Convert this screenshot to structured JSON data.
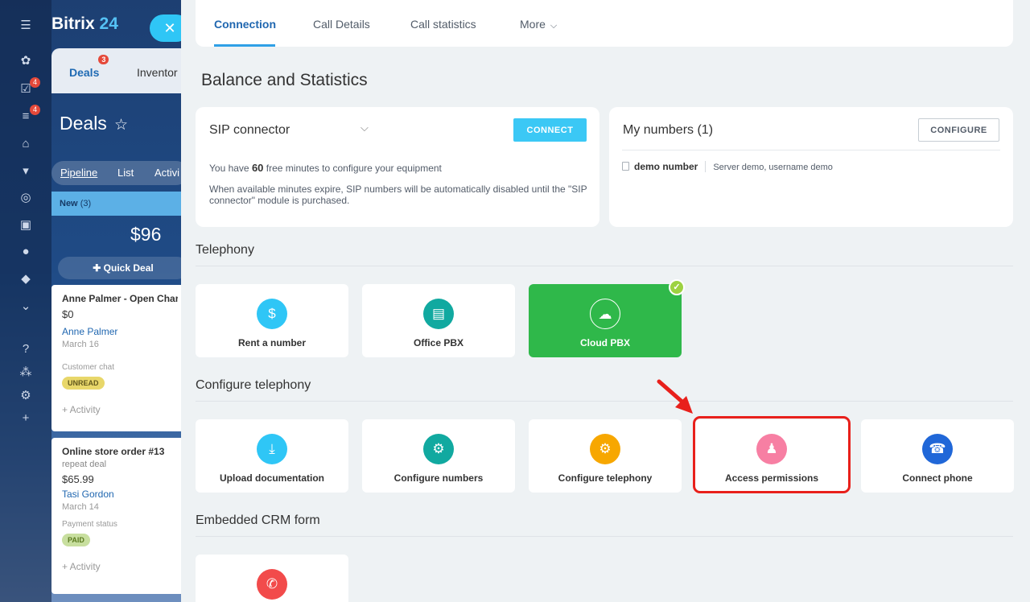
{
  "background": {
    "brand": {
      "name": "Bitrix",
      "number": "24"
    },
    "nav_badges": [
      "4",
      "4"
    ],
    "crm_tabs": {
      "deals": "Deals",
      "deals_badge": "3",
      "inventory": "Inventor"
    },
    "page_title": "Deals",
    "views": [
      "Pipeline",
      "List",
      "Activi"
    ],
    "stage": {
      "name": "New",
      "count": "(3)",
      "sum": "$96"
    },
    "quick_deal": "Quick Deal",
    "cards": [
      {
        "title": "Anne Palmer - Open Char",
        "subtitle": "",
        "price": "$0",
        "client": "Anne Palmer",
        "date": "March 16",
        "field": "Customer chat",
        "tag": "UNREAD",
        "activity": "+ Activity"
      },
      {
        "title": "Online store order #13",
        "subtitle": "repeat deal",
        "price": "$65.99",
        "client": "Tasi Gordon",
        "date": "March 14",
        "field": "Payment status",
        "tag": "PAID",
        "activity": "+ Activity"
      }
    ]
  },
  "tabs": [
    {
      "label": "Connection",
      "active": true
    },
    {
      "label": "Call Details",
      "active": false
    },
    {
      "label": "Call statistics",
      "active": false
    },
    {
      "label": "More",
      "active": false
    }
  ],
  "balance": {
    "title": "Balance and Statistics",
    "sip": {
      "title": "SIP connector",
      "connect_label": "CONNECT",
      "line1_pre": "You have",
      "minutes": "60",
      "line1_post": "free minutes to configure your equipment",
      "line2": "When available minutes expire, SIP numbers will be automatically disabled until the \"SIP connector\" module is purchased."
    },
    "numbers": {
      "title": "My numbers (1)",
      "configure_label": "CONFIGURE",
      "items": [
        {
          "name": "demo number",
          "detail": "Server demo, username demo"
        }
      ]
    }
  },
  "telephony": {
    "title": "Telephony",
    "tiles": [
      {
        "label": "Rent a number",
        "icon": "phone-dollar-icon",
        "color": "#2fc6f6",
        "selected": false
      },
      {
        "label": "Office PBX",
        "icon": "pbx-server-icon",
        "color": "#11a9a0",
        "selected": false
      },
      {
        "label": "Cloud PBX",
        "icon": "cloud-pbx-icon",
        "color": "#2fb84a",
        "selected": true
      }
    ]
  },
  "configure": {
    "title": "Configure telephony",
    "tiles": [
      {
        "label": "Upload documentation",
        "icon": "upload-document-icon",
        "color": "#2fc6f6"
      },
      {
        "label": "Configure numbers",
        "icon": "phone-gear-icon",
        "color": "#11a9a0"
      },
      {
        "label": "Configure telephony",
        "icon": "server-gear-icon",
        "color": "#f7a700"
      },
      {
        "label": "Access permissions",
        "icon": "user-lock-icon",
        "color": "#f77fa3"
      },
      {
        "label": "Connect phone",
        "icon": "plug-phone-icon",
        "color": "#2067d8"
      }
    ]
  },
  "embedded": {
    "title": "Embedded CRM form",
    "tiles": [
      {
        "label": "",
        "icon": "phone-form-icon",
        "color": "#f24b4b"
      }
    ]
  },
  "colors": {
    "accent": "#2067b0",
    "highlight": "#e8201b",
    "selected_tile": "#2fb84a"
  }
}
